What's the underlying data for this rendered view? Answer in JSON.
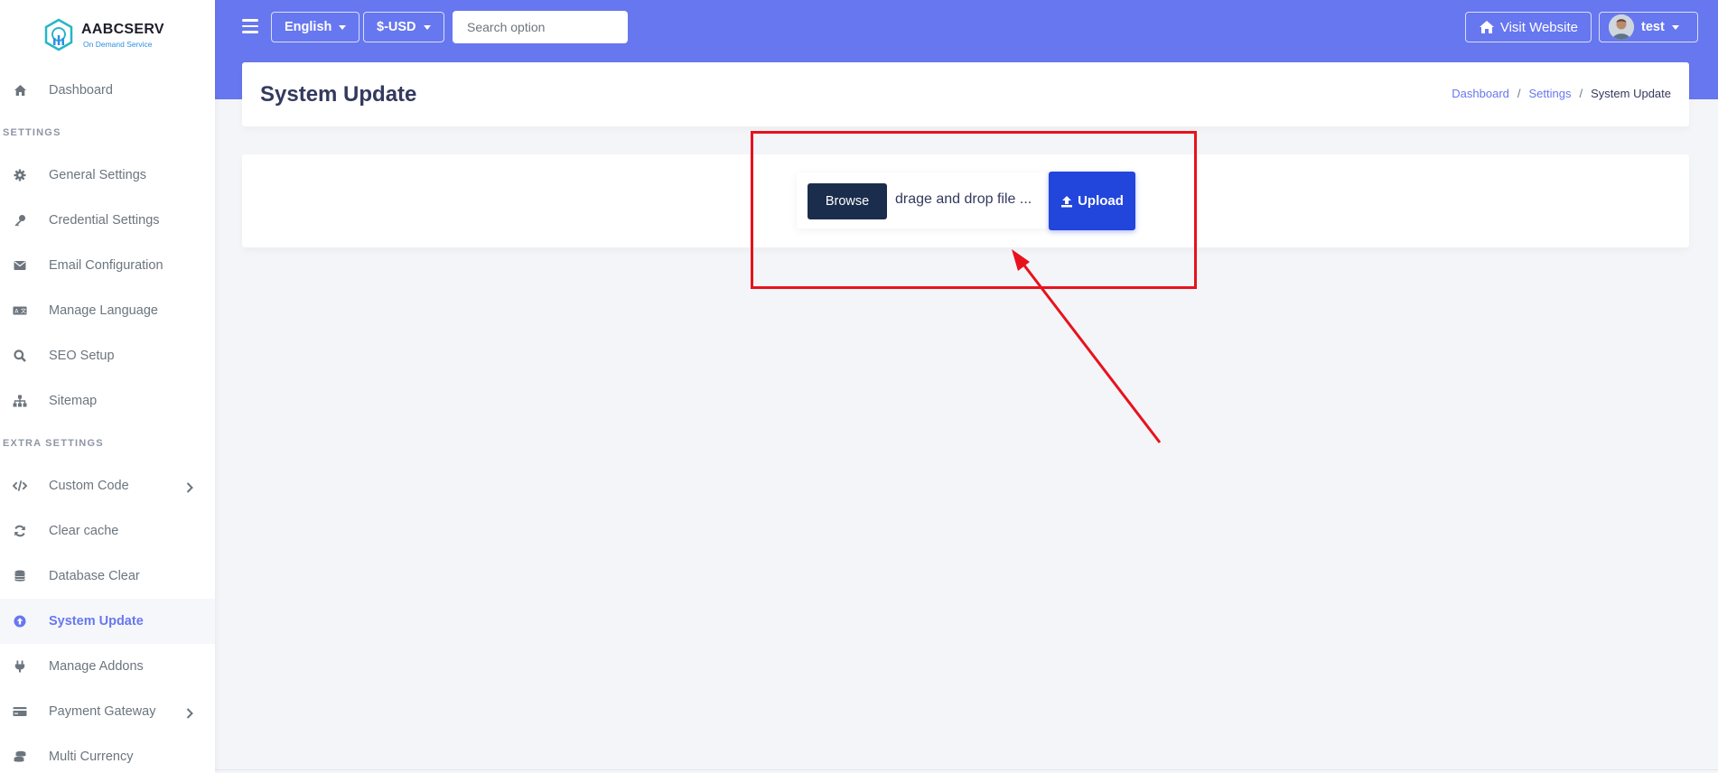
{
  "brand": {
    "name": "AABCSERV",
    "tagline": "On Demand Service"
  },
  "sidebar": {
    "items": [
      {
        "type": "item",
        "label": "Dashboard",
        "icon": "home-icon"
      },
      {
        "type": "header",
        "label": "SETTINGS"
      },
      {
        "type": "item",
        "label": "General Settings",
        "icon": "gear-icon"
      },
      {
        "type": "item",
        "label": "Credential Settings",
        "icon": "key-icon"
      },
      {
        "type": "item",
        "label": "Email Configuration",
        "icon": "envelope-icon"
      },
      {
        "type": "item",
        "label": "Manage Language",
        "icon": "language-icon"
      },
      {
        "type": "item",
        "label": "SEO Setup",
        "icon": "search-icon"
      },
      {
        "type": "item",
        "label": "Sitemap",
        "icon": "sitemap-icon"
      },
      {
        "type": "header",
        "label": "EXTRA SETTINGS"
      },
      {
        "type": "item",
        "label": "Custom Code",
        "icon": "code-icon",
        "chevron": true
      },
      {
        "type": "item",
        "label": "Clear cache",
        "icon": "refresh-icon"
      },
      {
        "type": "item",
        "label": "Database Clear",
        "icon": "database-icon"
      },
      {
        "type": "item",
        "label": "System Update",
        "icon": "arrow-circle-up-icon",
        "active": true
      },
      {
        "type": "item",
        "label": "Manage Addons",
        "icon": "plug-icon"
      },
      {
        "type": "item",
        "label": "Payment Gateway",
        "icon": "credit-card-icon",
        "chevron": true
      },
      {
        "type": "item",
        "label": "Multi Currency",
        "icon": "coins-icon"
      }
    ]
  },
  "topbar": {
    "language": "English",
    "currency": "$-USD",
    "search_placeholder": "Search option",
    "visit_website": "Visit Website",
    "user_name": "test"
  },
  "page": {
    "title": "System Update",
    "breadcrumb": {
      "home": "Dashboard",
      "parent": "Settings",
      "current": "System Update"
    }
  },
  "upload": {
    "browse_label": "Browse",
    "file_placeholder": "drage and drop file ...",
    "upload_label": "Upload"
  },
  "colors": {
    "primary": "#6777ef",
    "browse": "#1b2d4d",
    "upload": "#2245dc",
    "annotation": "#e8121c"
  }
}
